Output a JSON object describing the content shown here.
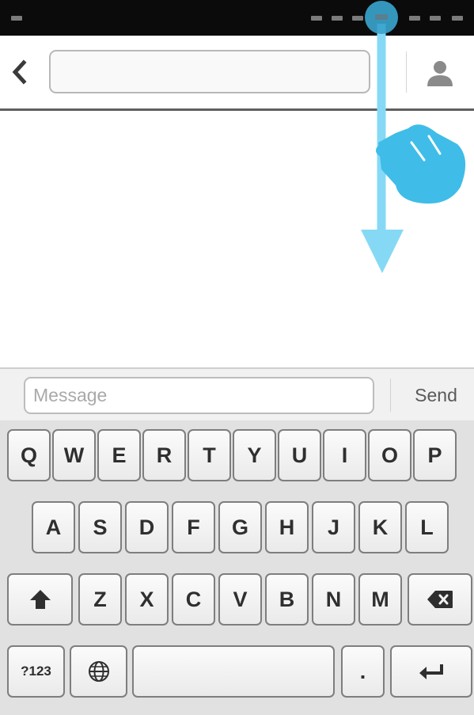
{
  "status_bar": {
    "indicators": [
      "status-indicator",
      "status-indicator",
      "status-indicator",
      "status-indicator",
      "status-indicator",
      "status-indicator"
    ]
  },
  "header": {
    "back_icon": "chevron-left-icon",
    "recipient_value": "",
    "contact_icon": "person-icon"
  },
  "compose": {
    "placeholder": "Message",
    "value": "",
    "send_label": "Send"
  },
  "keyboard": {
    "row1": [
      "Q",
      "W",
      "E",
      "R",
      "T",
      "Y",
      "U",
      "I",
      "O",
      "P"
    ],
    "row2": [
      "A",
      "S",
      "D",
      "F",
      "G",
      "H",
      "J",
      "K",
      "L"
    ],
    "row3": [
      "Z",
      "X",
      "C",
      "V",
      "B",
      "N",
      "M"
    ],
    "shift_icon": "shift-arrow-icon",
    "backspace_icon": "backspace-icon",
    "symbols_label": "?123",
    "globe_icon": "globe-icon",
    "period_label": ".",
    "enter_icon": "enter-return-icon"
  },
  "gesture": {
    "type": "swipe-down",
    "touch_icon": "touch-point-icon",
    "hand_icon": "pointing-hand-icon",
    "arrow_icon": "arrow-down-icon",
    "color": "#3fbde8",
    "arrow_color": "#86d9f5"
  }
}
